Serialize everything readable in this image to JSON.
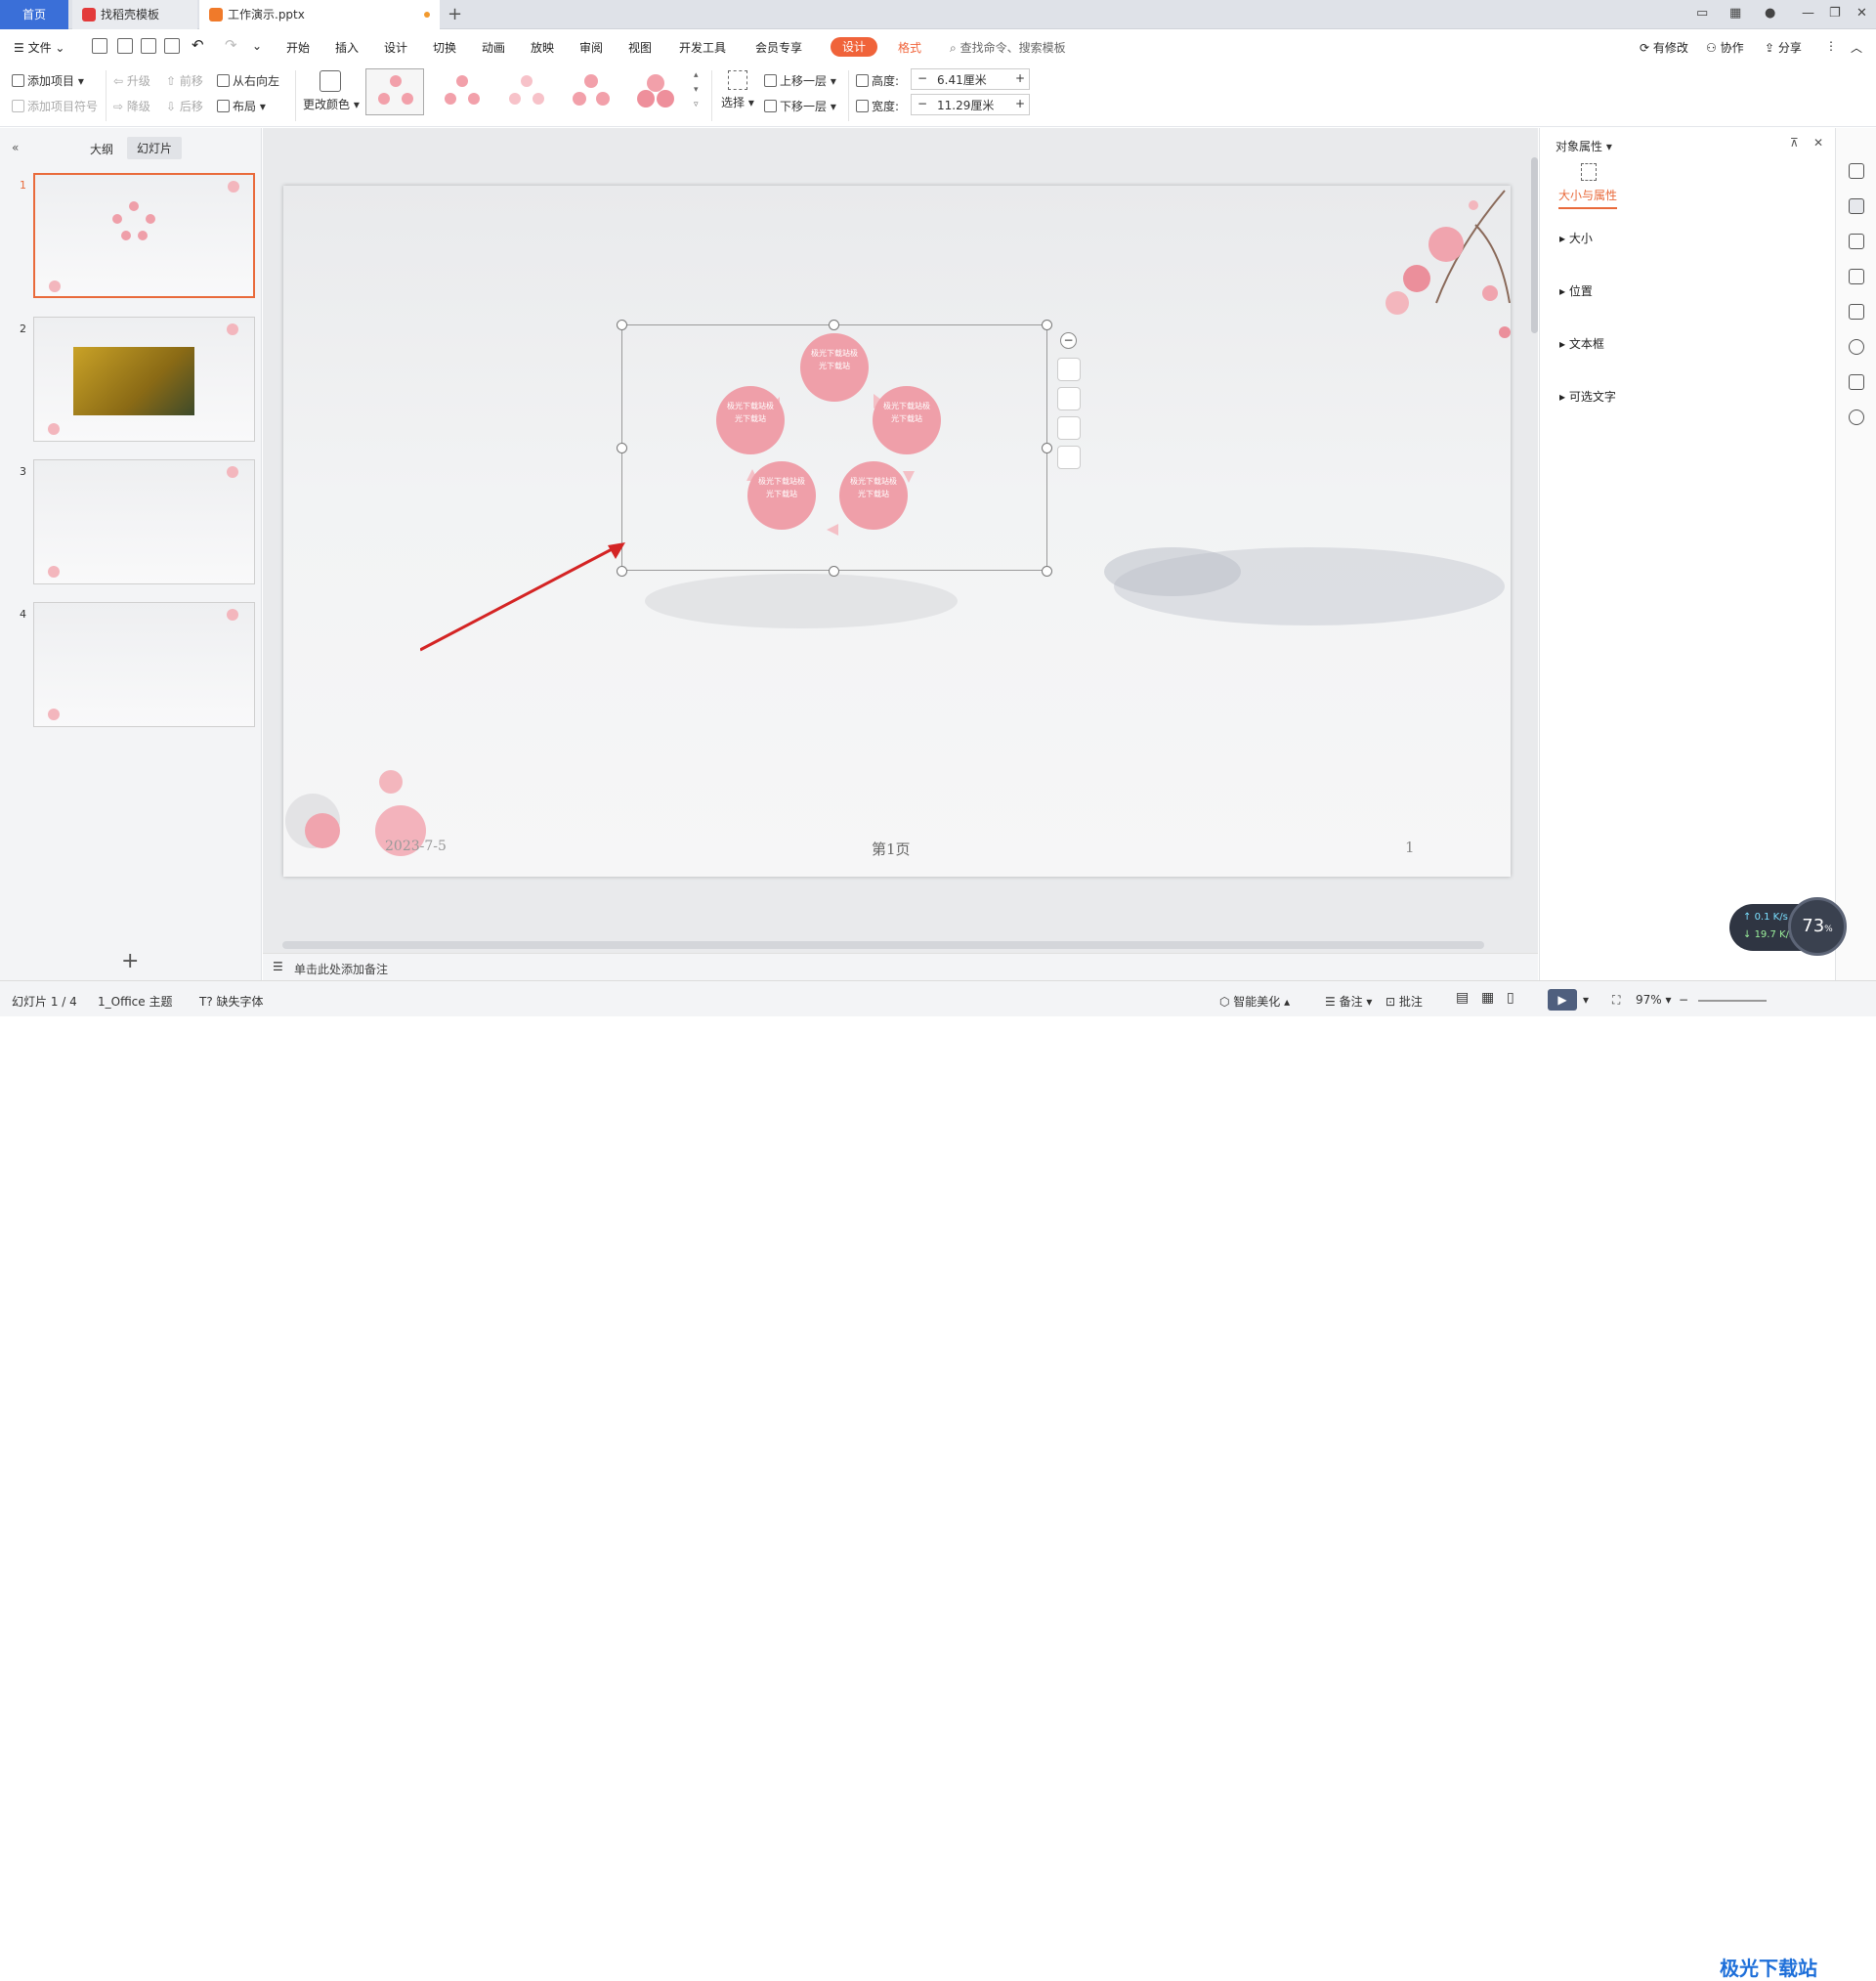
{
  "tabs": {
    "home": "首页",
    "template": "找稻壳模板",
    "doc": "工作演示.pptx",
    "new_tab": "+"
  },
  "menu": {
    "file": "文件",
    "items": [
      "开始",
      "插入",
      "设计",
      "切换",
      "动画",
      "放映",
      "审阅",
      "视图",
      "开发工具",
      "会员专享"
    ],
    "design_pill": "设计",
    "format": "格式",
    "search_placeholder": "查找命令、搜索模板",
    "modified": "有修改",
    "collab": "协作",
    "share": "分享"
  },
  "ribbon": {
    "add_item": "添加项目",
    "add_bullet": "添加项目符号",
    "promote": "升级",
    "demote": "降级",
    "forward": "前移",
    "backward": "后移",
    "rtl": "从右向左",
    "layout": "布局",
    "change_color": "更改颜色",
    "select": "选择",
    "bring_forward": "上移一层",
    "send_backward": "下移一层",
    "height_label": "高度:",
    "height_value": "6.41厘米",
    "width_label": "宽度:",
    "width_value": "11.29厘米"
  },
  "left_panel": {
    "outline_tab": "大纲",
    "slides_tab": "幻灯片",
    "slide_numbers": [
      "1",
      "2",
      "3",
      "4"
    ],
    "add_slide": "+"
  },
  "slide": {
    "circle_text": "极光下载站极光下载站",
    "date": "2023-7-5",
    "page_label": "第1页",
    "page_number": "1"
  },
  "notes_placeholder": "单击此处添加备注",
  "right_panel": {
    "title": "对象属性",
    "tab": "大小与属性",
    "sections": [
      "大小",
      "位置",
      "文本框",
      "可选文字"
    ]
  },
  "status": {
    "slide_counter": "幻灯片 1 / 4",
    "theme": "1_Office 主题",
    "missing_font": "缺失字体",
    "smart_beautify": "智能美化",
    "notes": "备注",
    "comments": "批注",
    "zoom": "97%"
  },
  "network": {
    "up": "0.1",
    "down": "19.7",
    "unit": "K/s",
    "percent": "73"
  },
  "watermark": "极光下载站",
  "colors": {
    "accent": "#f0633a",
    "home_tab": "#3a6fd8",
    "circle": "#ef9fa9",
    "selected_thumb": "#e96a3b"
  }
}
